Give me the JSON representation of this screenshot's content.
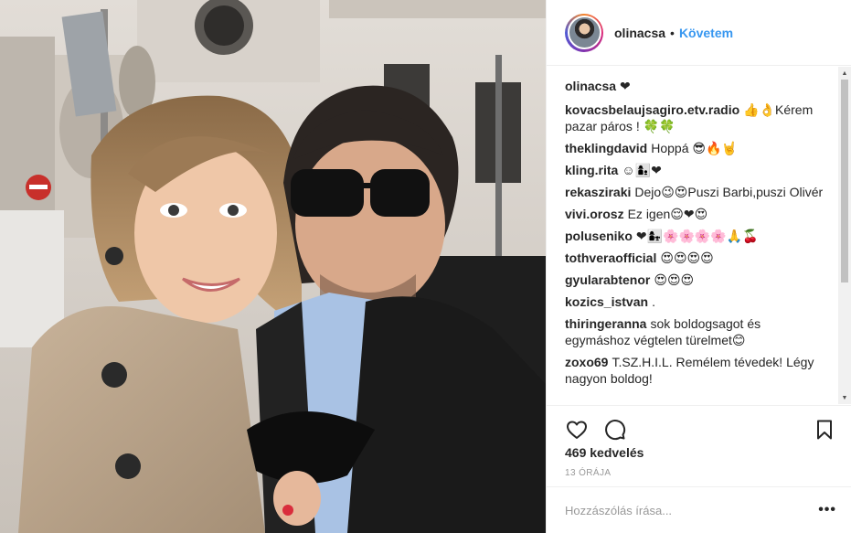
{
  "post": {
    "username": "olinacsa",
    "separator": "•",
    "follow_label": "Követem"
  },
  "caption": {
    "author": "olinacsa",
    "text": "❤"
  },
  "comments": [
    {
      "author": "kovacsbelaujsagiro.etv.radio",
      "text": "👍👌Kérem pazar páros ! 🍀🍀"
    },
    {
      "author": "theklingdavid",
      "text": "Hoppá 😎🔥🤘"
    },
    {
      "author": "kling.rita",
      "text": "☺👩‍👦❤"
    },
    {
      "author": "rekasziraki",
      "text": "Dejo😉😍Puszi Barbi,puszi Olivér"
    },
    {
      "author": "vivi.orosz",
      "text": "Ez igen😌❤😍"
    },
    {
      "author": "poluseniko",
      "text": "❤👩‍👧🌸🌸🌸🌸🙏🍒"
    },
    {
      "author": "tothveraofficial",
      "text": "😍😍😍😍"
    },
    {
      "author": "gyularabtenor",
      "text": "😍😍😍"
    },
    {
      "author": "kozics_istvan",
      "text": "."
    },
    {
      "author": "thiringeranna",
      "text": "sok boldogsagot és egymáshoz végtelen türelmet😊"
    },
    {
      "author": "zoxo69",
      "text": "T.SZ.H.I.L. Remélem tévedek! Légy nagyon boldog!"
    }
  ],
  "likes_text": "469 kedvelés",
  "time_text": "13 órája",
  "comment_input": {
    "placeholder": "Hozzászólás írása..."
  },
  "icons": {
    "like": "heart-icon",
    "comment": "comment-icon",
    "save": "bookmark-icon",
    "more": "more-options-icon"
  },
  "colors": {
    "accent": "#3897f0",
    "text": "#262626",
    "muted": "#999999",
    "border": "#efefef"
  }
}
